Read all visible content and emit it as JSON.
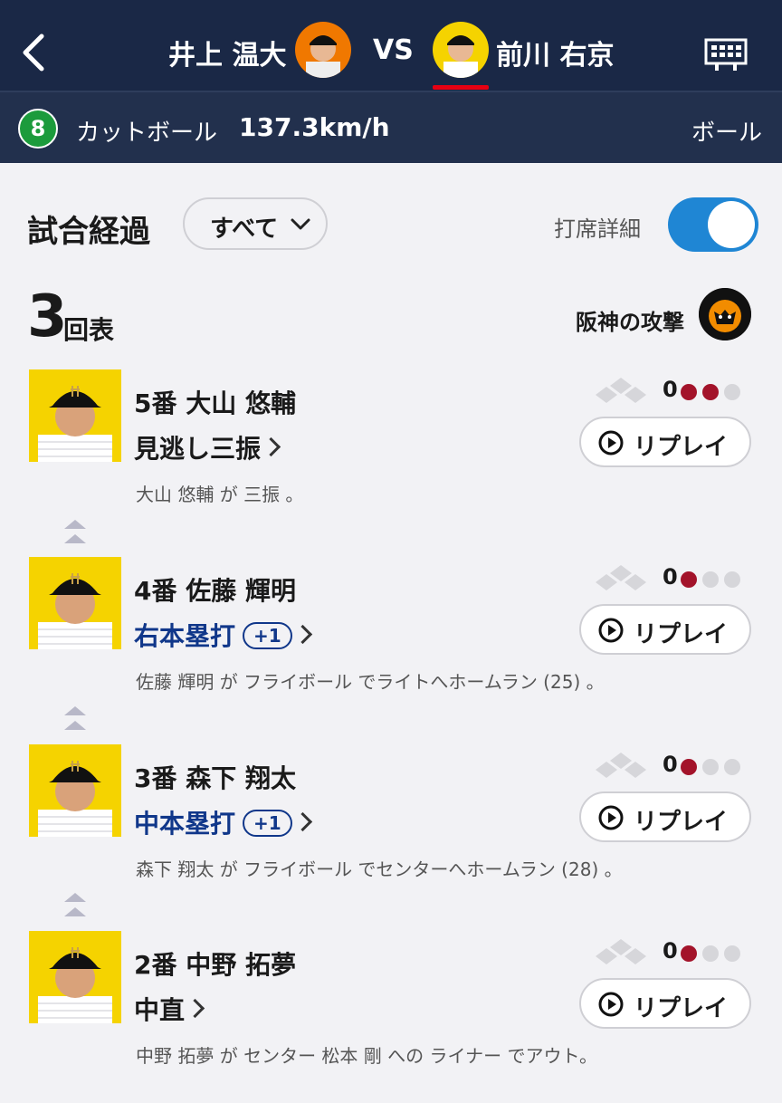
{
  "header": {
    "pitcher_name": "井上 温大",
    "vs_label": "VS",
    "batter_name": "前川 右京"
  },
  "pitch": {
    "number": "8",
    "type": "カットボール",
    "speed": "137.3km/h",
    "result": "ボール"
  },
  "section": {
    "title": "試合経過",
    "filter_label": "すべて",
    "detail_label": "打席詳細",
    "detail_toggle_on": true
  },
  "inning": {
    "number": "3",
    "half": "回表",
    "attack_label": "阪神の攻撃",
    "team_logo_text": "HANSHIN Tigers"
  },
  "plays": [
    {
      "batter": "5番 大山 悠輔",
      "outcome": "見逃し三振",
      "rbi": "",
      "outs": "0",
      "out_dots": 2,
      "replay_label": "リプレイ",
      "description": "大山 悠輔 が 三振 。"
    },
    {
      "batter": "4番 佐藤 輝明",
      "outcome": "右本塁打",
      "rbi": "+1",
      "outs": "0",
      "out_dots": 1,
      "replay_label": "リプレイ",
      "description": "佐藤 輝明 が フライボール でライトへホームラン (25) 。"
    },
    {
      "batter": "3番 森下 翔太",
      "outcome": "中本塁打",
      "rbi": "+1",
      "outs": "0",
      "out_dots": 1,
      "replay_label": "リプレイ",
      "description": "森下 翔太 が フライボール でセンターへホームラン (28) 。"
    },
    {
      "batter": "2番 中野 拓夢",
      "outcome": "中直",
      "rbi": "",
      "outs": "0",
      "out_dots": 1,
      "replay_label": "リプレイ",
      "description": "中野 拓夢 が センター 松本 剛 への ライナー でアウト。"
    }
  ],
  "colors": {
    "header_bg": "#1a2846",
    "accent_red": "#e60012",
    "toggle_blue": "#1f86d4",
    "homerun_blue": "#10378a",
    "out_dot_on": "#a3132a",
    "out_dot_off": "#d6d6da",
    "pitch_badge_green": "#1c9b3c"
  },
  "icons": [
    "back-arrow-icon",
    "scoreboard-icon",
    "chevron-down-icon",
    "play-icon",
    "base-diamond-icon",
    "up-arrow-icon"
  ]
}
